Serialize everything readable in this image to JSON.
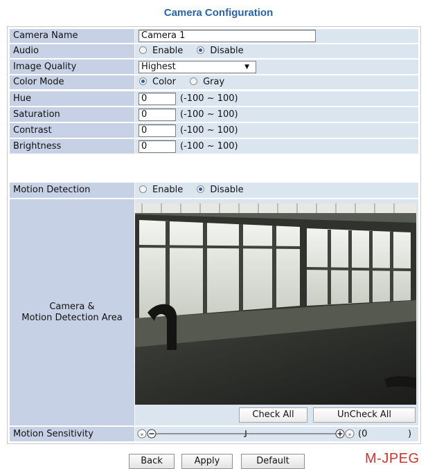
{
  "page": {
    "title": "Camera Configuration"
  },
  "form": {
    "camera_name": {
      "label": "Camera Name",
      "value": "Camera 1"
    },
    "audio": {
      "label": "Audio",
      "options": [
        "Enable",
        "Disable"
      ],
      "selected": "Disable"
    },
    "image_quality": {
      "label": "Image Quality",
      "value": "Highest"
    },
    "color_mode": {
      "label": "Color Mode",
      "options": [
        "Color",
        "Gray"
      ],
      "selected": "Color"
    },
    "hue": {
      "label": "Hue",
      "value": "0",
      "range": "(-100 ~ 100)"
    },
    "saturation": {
      "label": "Saturation",
      "value": "0",
      "range": "(-100 ~ 100)"
    },
    "contrast": {
      "label": "Contrast",
      "value": "0",
      "range": "(-100 ~ 100)"
    },
    "brightness": {
      "label": "Brightness",
      "value": "0",
      "range": "(-100 ~ 100)"
    },
    "motion_detection": {
      "label": "Motion Detection",
      "options": [
        "Enable",
        "Disable"
      ],
      "selected": "Disable"
    },
    "camera_area": {
      "label_line1": "Camera &",
      "label_line2": "Motion Detection Area"
    },
    "area_buttons": {
      "check_all": "Check All",
      "uncheck_all": "UnCheck All"
    },
    "motion_sensitivity": {
      "label": "Motion Sensitivity",
      "value_text": "(0",
      "close_paren": ")",
      "level": 0.5
    }
  },
  "footer": {
    "back": "Back",
    "apply": "Apply",
    "default": "Default",
    "stream_format": "M-JPEG"
  },
  "colors": {
    "title": "#2a63a8",
    "label_bg": "#c7d1e6",
    "value_bg": "#dbe5f0",
    "radio_checked": "#2b5ea8",
    "stream_format": "#d0342c"
  }
}
